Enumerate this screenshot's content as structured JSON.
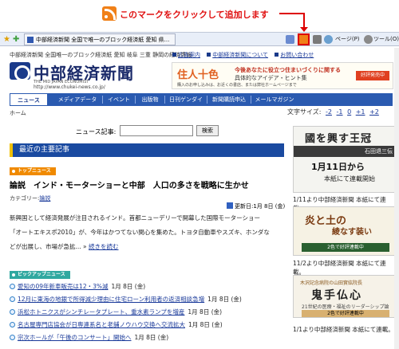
{
  "banner": {
    "text": "このマークをクリックして追加します"
  },
  "browser": {
    "tab_title": "中部経済新聞 全国で唯一のブロック経済紙 愛知 県...",
    "page_menu": "ページ(P)",
    "tools_menu": "ツール(O)"
  },
  "site": {
    "tagline": "中部経済新聞 全国唯一のブロック経済紙 愛知 岐阜 三重 静岡の経済情報",
    "logo_text": "中部経済新聞",
    "logo_sub": "THE MID JAPAN ECONOMIST",
    "logo_url": "http://www.chukei-news.co.jp/",
    "header_links": [
      "広告案内",
      "中部経済新聞について",
      "お問い合わせ"
    ],
    "ad": {
      "title": "住人十色",
      "line1": "今後あなたに役立つ住まいづくりに関する",
      "line2": "具体的なアイデア・ヒント集",
      "line3": "購入のお申し込みは、お近くの書店、または弊社ホームページまで",
      "badge": "好評発売中"
    }
  },
  "nav": {
    "items": [
      "ニュース",
      "メディアデータ",
      "イベント",
      "出版物",
      "日刊ゲンダイ",
      "新聞購読申込",
      "メールマガジン"
    ]
  },
  "crumb": "ホーム",
  "fontsize": {
    "label": "文字サイズ",
    "options": [
      "-2",
      "-1",
      "0",
      "+1",
      "+2"
    ]
  },
  "search": {
    "label": "ニュース記事:",
    "button": "検索"
  },
  "main": {
    "section_title": "最近の主要記事",
    "top_ribbon": "トップニュース",
    "article_title": "論説　インド・モーターショーと中部　人口の多さを戦略に生かせ",
    "category_label": "カテゴリー:",
    "category": "論説",
    "updated": "更新日:1月 8日 (金)",
    "body": [
      "新興国として経済発展が注目されるインド。首都ニューデリーで開幕した国際モーターショー",
      "「オートエキスポ2010」が、今年はかつてない関心を集めた。トヨタ自動車やスズキ、ホンダな",
      "どが出展し、市場が急拡..."
    ],
    "read_more": "続きを読む",
    "pick_ribbon": "ピックアップニュース",
    "news": [
      {
        "title": "愛知の09年新車販売は12・3%減",
        "date": "1月 8日 (金)"
      },
      {
        "title": "12月に東海の地銀で所得減少理由に住宅ローン利用者の返済相談急増",
        "date": "1月 8日 (金)"
      },
      {
        "title": "浜松ホトニクスがシンチレータプレート、重水素ランプを増産",
        "date": "1月 8日 (金)"
      },
      {
        "title": "名古屋専門店協会が日専連系名と老舗ノウハウ交換へ交流拡大",
        "date": "1月 8日 (金)"
      },
      {
        "title": "宗次ホールが「午後のコンサート」開始へ",
        "date": "1月 8日 (金)"
      }
    ]
  },
  "sidebar": {
    "s1": {
      "title": "國を興す王冠",
      "band": "石田退三伝",
      "date": "1月11日から",
      "start": "本紙にて連載開始"
    },
    "s1_caption": "1/11より中部経済新聞 本紙にて連載。",
    "s2": {
      "title": "炎と土の",
      "title2": "綾なす装い",
      "band": "2色で好評連載中"
    },
    "s2_caption": "11/2より中部経済新聞 本紙にて連載。",
    "s3": {
      "top": "木沢記念病院の山田實紘院長",
      "title": "鬼手仏心",
      "sub": "21世紀の医療・福祉のリーダーシップ論",
      "band": "2色で好評連載中"
    },
    "s3_caption": "1/1より中部経済新聞 本紙にて連載。"
  }
}
